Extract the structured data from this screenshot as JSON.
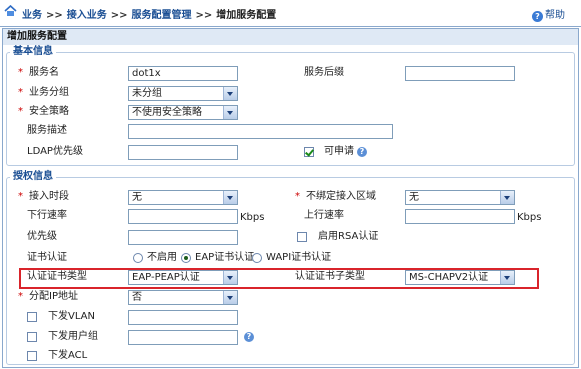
{
  "breadcrumb": {
    "items": [
      "业务",
      "接入业务",
      "服务配置管理",
      "增加服务配置"
    ],
    "separator": ">>"
  },
  "help_label": "帮助",
  "panel_title": "增加服务配置",
  "basic": {
    "legend": "基本信息",
    "service_name_label": "服务名",
    "service_name_value": "dot1x",
    "service_suffix_label": "服务后缀",
    "service_suffix_value": "",
    "business_group_label": "业务分组",
    "business_group_value": "未分组",
    "security_policy_label": "安全策略",
    "security_policy_value": "不使用安全策略",
    "description_label": "服务描述",
    "description_value": "",
    "ldap_priority_label": "LDAP优先级",
    "ldap_priority_value": "",
    "applicable_label": "可申请"
  },
  "auth": {
    "legend": "授权信息",
    "access_period_label": "接入时段",
    "access_period_value": "无",
    "unbound_area_label": "不绑定接入区域",
    "unbound_area_value": "无",
    "downlink_rate_label": "下行速率",
    "downlink_rate_value": "",
    "uplink_rate_label": "上行速率",
    "uplink_rate_value": "",
    "rate_unit": "Kbps",
    "priority_label": "优先级",
    "priority_value": "",
    "enable_rsa_label": "启用RSA认证",
    "cert_auth_label": "证书认证",
    "cert_options": [
      "不启用",
      "EAP证书认证",
      "WAPI证书认证"
    ],
    "cert_type_label": "认证证书类型",
    "cert_type_value": "EAP-PEAP认证",
    "cert_subtype_label": "认证证书子类型",
    "cert_subtype_value": "MS-CHAPV2认证",
    "assign_ip_label": "分配IP地址",
    "assign_ip_value": "否",
    "deploy_vlan_label": "下发VLAN",
    "deploy_vlan_value": "",
    "deploy_usergroup_label": "下发用户组",
    "deploy_usergroup_value": "",
    "deploy_acl_label": "下发ACL",
    "deploy_acl_value": ""
  },
  "required_mark": "*",
  "icons": {
    "home": "home-icon",
    "help": "help-icon",
    "question": "question-icon"
  },
  "colors": {
    "link": "#1a4e93",
    "required": "#cc0000",
    "highlight": "#d9242b",
    "panel_header": "#dfe9f5"
  }
}
